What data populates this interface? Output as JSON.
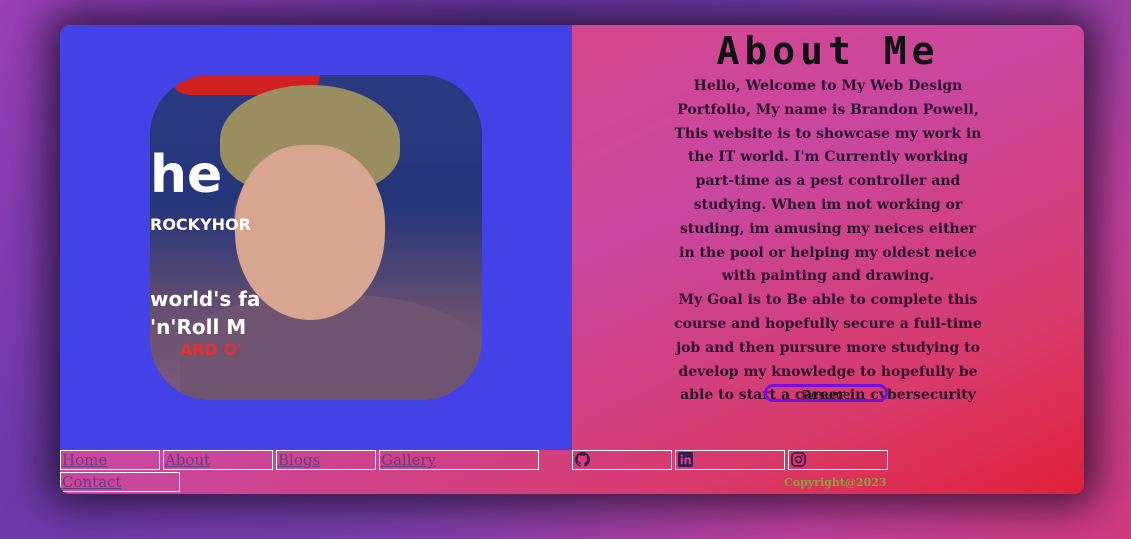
{
  "about": {
    "title": "About Me",
    "paragraph1": "Hello, Welcome to My Web Design Portfolio, My name is Brandon Powell, This website is to showcase my work in the IT world. I'm Currently working part-time as a pest controller and studying. When im not working or studing, im amusing my neices either in the pool or helping my oldest neice with painting and drawing.",
    "paragraph2": "My Goal is to Be able to complete this course and hopefully secure a full-time job and then pursure more studying to develop my knowledge to hopefully be able to start a career in cybersecurity",
    "resume_label": "Resume"
  },
  "photo": {
    "sign_text_1": "he",
    "sign_text_2": "ROCKYHOR",
    "sign_text_3": "world's fa",
    "sign_text_4": "'n'Roll M",
    "sign_text_5": "ARD O'"
  },
  "nav": {
    "home": "Home",
    "about": "About",
    "blogs": "Blogs",
    "gallery": "Gallery",
    "contact": "Contact"
  },
  "social": {
    "github": "github-icon",
    "linkedin": "linkedin-icon",
    "instagram": "instagram-icon"
  },
  "footer": {
    "copyright": "Copyright@2023"
  },
  "colors": {
    "left_panel": "#4242e6",
    "resume_border": "#7a10e0",
    "copyright": "#8fa23a"
  }
}
